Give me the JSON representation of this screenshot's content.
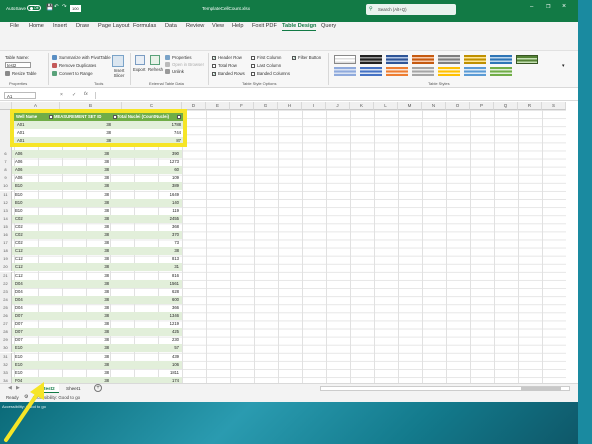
{
  "title_bar": {
    "autosave_label": "AutoSave",
    "autosave_state": "Off",
    "zoom_value": "100",
    "doc_title": "TemplateCellCount.xlsx",
    "search_placeholder": "Search (Alt+Q)"
  },
  "menu": {
    "tabs": [
      "File",
      "Home",
      "Insert",
      "Draw",
      "Page Layout",
      "Formulas",
      "Data",
      "Review",
      "View",
      "Help",
      "Foxit PDF",
      "Table Design",
      "Query"
    ],
    "active": "Table Design"
  },
  "ribbon": {
    "table_name_label": "Table Name:",
    "table_name_value": "test2",
    "resize_table": "Resize Table",
    "properties_group": "Properties",
    "summarize": "Summarize with PivotTable",
    "remove_duplicates": "Remove Duplicates",
    "convert_range": "Convert to Range",
    "insert_slicer": "Insert Slicer",
    "tools_group": "Tools",
    "export": "Export",
    "refresh": "Refresh",
    "props": "Properties",
    "open_browser": "Open in Browser",
    "unlink": "Unlink",
    "external_group": "External Table Data",
    "header_row": "Header Row",
    "total_row": "Total Row",
    "banded_rows": "Banded Rows",
    "first_column": "First Column",
    "last_column": "Last Column",
    "banded_columns": "Banded Columns",
    "filter_button": "Filter Button",
    "style_options_group": "Table Style Options",
    "styles_group": "Table Styles"
  },
  "formula_bar": {
    "name_box": "A1",
    "fx": "fx"
  },
  "columns": [
    "A",
    "B",
    "C",
    "D",
    "E",
    "F",
    "G",
    "H",
    "I",
    "J",
    "K",
    "L",
    "M",
    "N",
    "O",
    "P",
    "Q",
    "R",
    "S"
  ],
  "table": {
    "headers": [
      "Well Name",
      "MEASUREMENT SET ID",
      "Total Nuclei (CountNuclei)"
    ],
    "top_rows": [
      [
        "A01",
        "38",
        "1788"
      ],
      [
        "A01",
        "38",
        "744"
      ],
      [
        "A01",
        "38",
        "87"
      ]
    ],
    "rows": [
      {
        "n": "6",
        "a": "A06",
        "b": "38",
        "c": "390"
      },
      {
        "n": "7",
        "a": "A06",
        "b": "38",
        "c": "1273"
      },
      {
        "n": "8",
        "a": "A06",
        "b": "38",
        "c": "60"
      },
      {
        "n": "9",
        "a": "A06",
        "b": "38",
        "c": "109"
      },
      {
        "n": "10",
        "a": "B10",
        "b": "38",
        "c": "389"
      },
      {
        "n": "11",
        "a": "B10",
        "b": "38",
        "c": "1649"
      },
      {
        "n": "12",
        "a": "B10",
        "b": "38",
        "c": "140"
      },
      {
        "n": "13",
        "a": "B10",
        "b": "38",
        "c": "119"
      },
      {
        "n": "14",
        "a": "C02",
        "b": "38",
        "c": "2455"
      },
      {
        "n": "15",
        "a": "C02",
        "b": "38",
        "c": "368"
      },
      {
        "n": "16",
        "a": "C02",
        "b": "38",
        "c": "370"
      },
      {
        "n": "17",
        "a": "C02",
        "b": "38",
        "c": "73"
      },
      {
        "n": "18",
        "a": "C12",
        "b": "38",
        "c": "38"
      },
      {
        "n": "19",
        "a": "C12",
        "b": "38",
        "c": "813"
      },
      {
        "n": "20",
        "a": "C12",
        "b": "38",
        "c": "31"
      },
      {
        "n": "21",
        "a": "C12",
        "b": "38",
        "c": "816"
      },
      {
        "n": "22",
        "a": "D04",
        "b": "38",
        "c": "1561"
      },
      {
        "n": "23",
        "a": "D04",
        "b": "38",
        "c": "628"
      },
      {
        "n": "24",
        "a": "D04",
        "b": "38",
        "c": "600"
      },
      {
        "n": "25",
        "a": "D04",
        "b": "38",
        "c": "366"
      },
      {
        "n": "26",
        "a": "D07",
        "b": "38",
        "c": "1346"
      },
      {
        "n": "27",
        "a": "D07",
        "b": "38",
        "c": "1219"
      },
      {
        "n": "28",
        "a": "D07",
        "b": "38",
        "c": "425"
      },
      {
        "n": "29",
        "a": "D07",
        "b": "38",
        "c": "230"
      },
      {
        "n": "30",
        "a": "E10",
        "b": "38",
        "c": "57"
      },
      {
        "n": "31",
        "a": "E10",
        "b": "38",
        "c": "439"
      },
      {
        "n": "32",
        "a": "E10",
        "b": "38",
        "c": "106"
      },
      {
        "n": "33",
        "a": "E10",
        "b": "38",
        "c": "1811"
      },
      {
        "n": "34",
        "a": "F04",
        "b": "38",
        "c": "174"
      },
      {
        "n": "35",
        "a": "F04",
        "b": "38",
        "c": "74"
      },
      {
        "n": "36",
        "a": "F04",
        "b": "38",
        "c": "1641"
      },
      {
        "n": "37",
        "a": "F04",
        "b": "38",
        "c": "1211"
      }
    ]
  },
  "sheets": [
    "test2",
    "Sheet1"
  ],
  "active_sheet": "test2",
  "status": {
    "ready": "Ready",
    "accessibility": "Accessibility: Good to go"
  },
  "colors": {
    "excel_green": "#127a45",
    "table_header": "#70ad47",
    "band": "#e2efda",
    "highlight": "#f6e527"
  }
}
